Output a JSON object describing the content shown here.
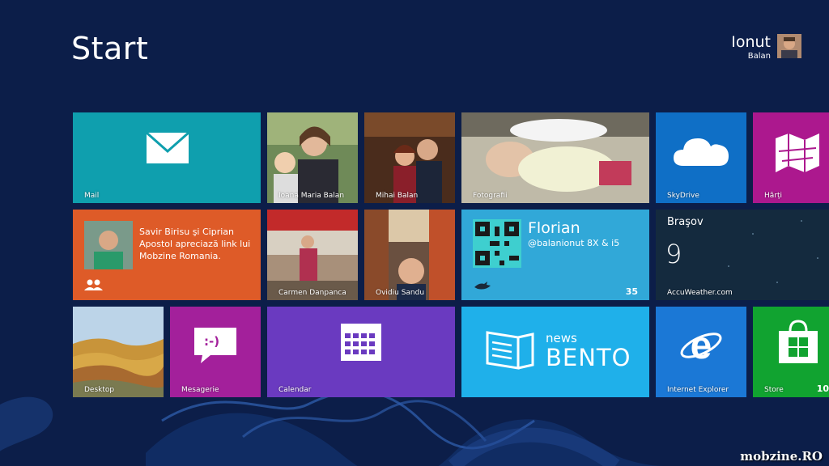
{
  "start_title": "Start",
  "user": {
    "first_name": "Ionut",
    "last_name": "Balan"
  },
  "colors": {
    "background": "#0c1e49",
    "mail": "#0f9fae",
    "people": "#de5b28",
    "twitter": "#31a8d8",
    "weather": "#122238",
    "skydrive": "#0f6fc6",
    "maps": "#ac188e",
    "messaging": "#a3209b",
    "calendar": "#6a3ac0",
    "bento": "#1fb0ea",
    "ie": "#1b78d6",
    "store": "#11a330"
  },
  "tiles": {
    "mail": {
      "label": "Mail",
      "icon": "envelope-icon"
    },
    "photo1": {
      "label": "Ioana Maria Balan"
    },
    "photo2": {
      "label": "Mihai Balan"
    },
    "photos": {
      "label": "Fotografii"
    },
    "skydrive": {
      "label": "SkyDrive",
      "icon": "cloud-icon"
    },
    "maps": {
      "label": "Hărți",
      "icon": "map-icon"
    },
    "people": {
      "text": "Savir Birisu şi Ciprian Apostol apreciază link lui Mobzine Romania.",
      "icon": "people-icon"
    },
    "photo3": {
      "label": "Carmen Danpanca"
    },
    "photo4": {
      "label": "Ovidiu Sandu"
    },
    "twitter": {
      "name": "Florian",
      "handle": "@balanionut 8X & i5",
      "count": "35",
      "icon": "bird-icon"
    },
    "weather": {
      "city": "Braşov",
      "temp": "9",
      "provider": "AccuWeather.com"
    },
    "desktop": {
      "label": "Desktop"
    },
    "messaging": {
      "label": "Mesagerie",
      "icon": "chat-icon",
      "glyph": ":-)"
    },
    "calendar": {
      "label": "Calendar",
      "icon": "calendar-icon"
    },
    "bento": {
      "small": "news",
      "big": "BENTO",
      "icon": "bento-logo-icon"
    },
    "ie": {
      "label": "Internet Explorer",
      "icon": "ie-icon"
    },
    "store": {
      "label": "Store",
      "icon": "store-bag-icon",
      "count": "10"
    }
  },
  "watermark": "mobzine.RO"
}
